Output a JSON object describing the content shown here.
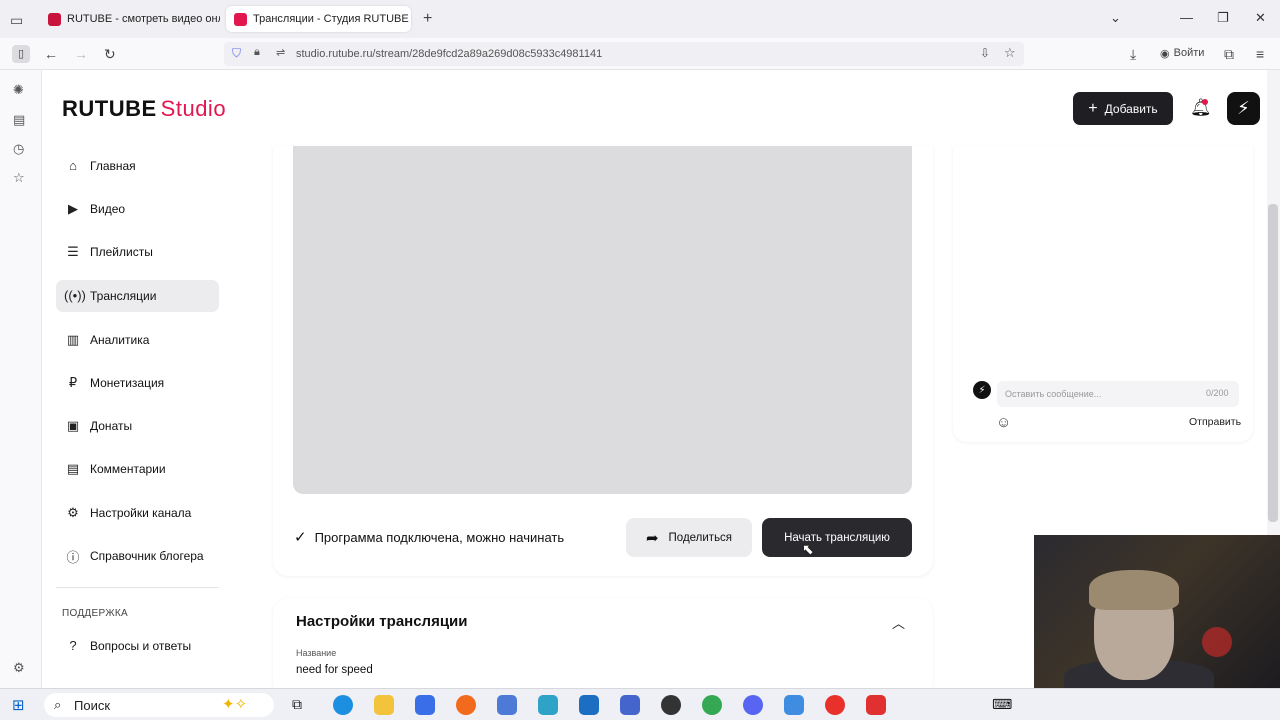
{
  "browser": {
    "tabs": [
      {
        "label": "RUTUBE - смотреть видео онл",
        "active": false
      },
      {
        "label": "Трансляции - Студия RUTUBE",
        "active": true
      }
    ],
    "url": "studio.rutube.ru/stream/28de9fcd2a89a269d08c5933c4981141",
    "login_label": "Войти"
  },
  "header": {
    "logo_main": "RUTUBE",
    "logo_studio": "Studio",
    "add_label": "Добавить"
  },
  "sidebar": {
    "items": [
      {
        "label": "Главная",
        "icon": "home-icon"
      },
      {
        "label": "Видео",
        "icon": "video-icon"
      },
      {
        "label": "Плейлисты",
        "icon": "playlist-icon"
      },
      {
        "label": "Трансляции",
        "icon": "broadcast-icon",
        "active": true
      },
      {
        "label": "Аналитика",
        "icon": "analytics-icon"
      },
      {
        "label": "Монетизация",
        "icon": "ruble-icon"
      },
      {
        "label": "Донаты",
        "icon": "wallet-icon"
      },
      {
        "label": "Комментарии",
        "icon": "comment-icon"
      },
      {
        "label": "Настройки канала",
        "icon": "gear-icon"
      },
      {
        "label": "Справочник блогера",
        "icon": "info-icon"
      }
    ],
    "support_label": "ПОДДЕРЖКА",
    "faq_label": "Вопросы и ответы"
  },
  "stream": {
    "status_text": "Программа подключена, можно начинать",
    "share_label": "Поделиться",
    "start_label": "Начать трансляцию"
  },
  "settings": {
    "title": "Настройки трансляции",
    "name_label": "Название",
    "name_value": "need for speed"
  },
  "chat": {
    "placeholder": "Оставить сообщение...",
    "char_count": "0/200",
    "send_label": "Отправить"
  },
  "taskbar": {
    "search_label": "Поиск"
  },
  "colors": {
    "brand": "#e2174d",
    "dark_button": "#1f1f23",
    "active_menu_bg": "#ececee"
  }
}
